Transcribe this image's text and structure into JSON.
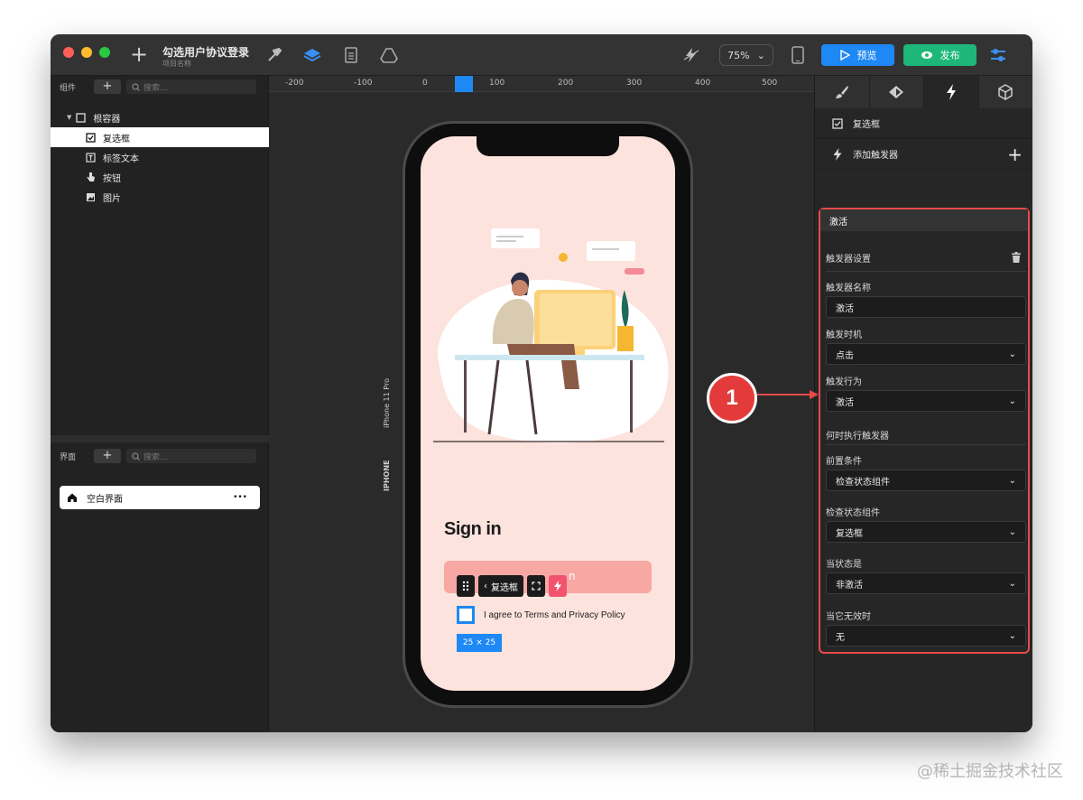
{
  "app": {
    "project_title": "勾选用户协议登录",
    "project_subtitle": "项目名称",
    "zoom": "75%",
    "preview_label": "预览",
    "publish_label": "发布"
  },
  "left": {
    "components_label": "组件",
    "search_placeholder": "搜索...",
    "tree": [
      {
        "label": "根容器",
        "icon": "checkbox-empty-icon"
      },
      {
        "label": "复选框",
        "icon": "checkbox-icon"
      },
      {
        "label": "标签文本",
        "icon": "text-icon"
      },
      {
        "label": "按钮",
        "icon": "hand-pointer-icon"
      },
      {
        "label": "图片",
        "icon": "image-icon"
      }
    ],
    "pages_label": "界面",
    "pages_search_placeholder": "搜索...",
    "page_item": "空白界面",
    "page_more": "•••"
  },
  "ruler": [
    "-200",
    "-100",
    "0",
    "100",
    "200",
    "300",
    "400",
    "500"
  ],
  "device": {
    "label": "iPhone 11 Pro",
    "label2": "IPHONE"
  },
  "phone_screen": {
    "signin": "Sign in",
    "pinkbar_text": "n",
    "toolbar_back": "复选框",
    "agree_text": "I agree to Terms and Privacy Policy",
    "size_tag": "25 × 25"
  },
  "right": {
    "selected_component": "复选框",
    "add_trigger": "添加触发器",
    "trigger_header": "激活",
    "settings_label": "触发器设置",
    "name_label": "触发器名称",
    "name_value": "激活",
    "timing_label": "触发时机",
    "timing_value": "点击",
    "action_label": "触发行为",
    "action_value": "激活",
    "when_label": "何时执行触发器",
    "pre_label": "前置条件",
    "pre_value": "检查状态组件",
    "check_label": "检查状态组件",
    "check_value": "复选框",
    "state_label": "当状态是",
    "state_value": "非激活",
    "invalid_label": "当它无效时",
    "invalid_value": "无"
  },
  "annotation": {
    "badge": "1"
  },
  "watermark": "@稀土掘金技术社区",
  "colors": {
    "accent": "#1e88f5",
    "publish": "#1db77a",
    "highlight": "#e84a4a",
    "screen_bg": "#fde3dd"
  }
}
